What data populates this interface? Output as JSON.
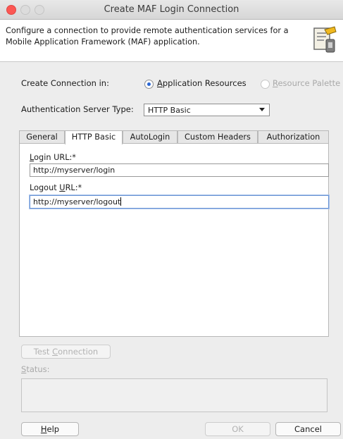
{
  "window": {
    "title": "Create MAF Login Connection"
  },
  "header": {
    "description": "Configure a connection to provide remote authentication services for a Mobile Application Framework (MAF) application.",
    "icon": "connection-wizard-icon"
  },
  "create_connection": {
    "label": "Create Connection in:",
    "options": [
      {
        "label_prefix": "",
        "label_underline": "A",
        "label_rest": "pplication Resources",
        "selected": true,
        "enabled": true
      },
      {
        "label_prefix": "",
        "label_underline": "R",
        "label_rest": "esource Palette",
        "selected": false,
        "enabled": false
      }
    ]
  },
  "auth_server": {
    "label": "Authentication Server Type:",
    "selected": "HTTP Basic"
  },
  "tabs": [
    {
      "label": "General",
      "active": false
    },
    {
      "label": "HTTP Basic",
      "active": true
    },
    {
      "label": "AutoLogin",
      "active": false
    },
    {
      "label": "Custom Headers",
      "active": false
    },
    {
      "label": "Authorization",
      "active": false
    }
  ],
  "fields": {
    "login_url": {
      "label_u": "L",
      "label_rest": "ogin URL:*",
      "value": "http://myserver/login"
    },
    "logout_url": {
      "label_pre": "Logout ",
      "label_u": "U",
      "label_rest": "RL:*",
      "value": "http://myserver/logout"
    }
  },
  "test_connection": {
    "label_pre": "Test ",
    "label_u": "C",
    "label_rest": "onnection"
  },
  "status": {
    "label_u": "S",
    "label_rest": "tatus:",
    "value": ""
  },
  "footer": {
    "help": {
      "label_u": "H",
      "label_rest": "elp"
    },
    "ok": "OK",
    "cancel": "Cancel"
  }
}
